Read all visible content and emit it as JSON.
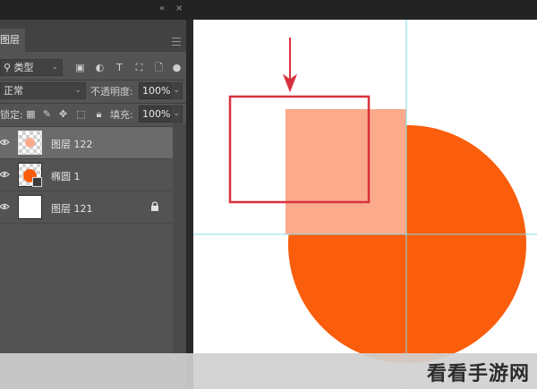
{
  "panel": {
    "tab_label": "图层",
    "filter": {
      "kind_label": "类型"
    },
    "blend": {
      "mode": "正常",
      "opacity_label": "不透明度:",
      "opacity_value": "100%"
    },
    "lock_row": {
      "lock_label": "锁定:",
      "fill_label": "填充:",
      "fill_value": "100%"
    },
    "layers": [
      {
        "name": "图层 122",
        "selected": true
      },
      {
        "name": "椭圆 1",
        "selected": false
      },
      {
        "name": "图层 121",
        "selected": false,
        "locked": true
      }
    ]
  },
  "canvas": {
    "colors": {
      "circle": "#FA5D0B",
      "square": "#FBAA8C",
      "highlight_box": "#D9313D",
      "guide": "#7FE0EA"
    }
  },
  "watermark": "看看手游网"
}
